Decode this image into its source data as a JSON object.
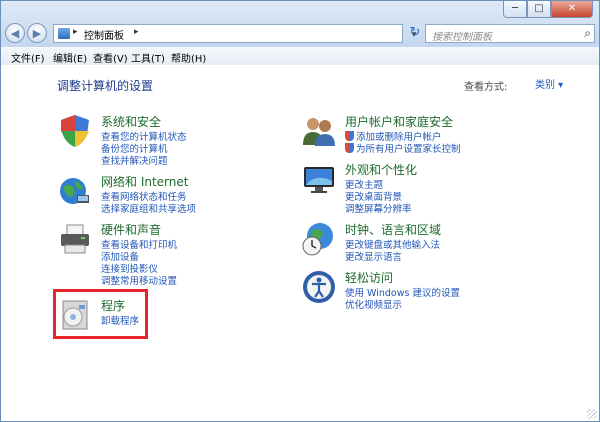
{
  "window": {
    "controls": {
      "minimize": "─",
      "maximize": "□",
      "close": "✕"
    }
  },
  "nav": {
    "back": "◀",
    "forward": "▶",
    "address": {
      "crumb": "控制面板",
      "sep1": "▸",
      "sep2": "▸",
      "dropdown": "▾"
    },
    "refresh": "↻",
    "search_placeholder": "搜索控制面板",
    "search_icon": "⌕"
  },
  "menu": {
    "items": [
      "文件(F)",
      "编辑(E)",
      "查看(V)",
      "工具(T)",
      "帮助(H)"
    ]
  },
  "main": {
    "title": "调整计算机的设置",
    "view_by_label": "查看方式:",
    "view_by_value": "类别 ▾"
  },
  "left_categories": [
    {
      "title": "系统和安全",
      "links": [
        "查看您的计算机状态",
        "备份您的计算机",
        "查找并解决问题"
      ],
      "icon": "shield-icon"
    },
    {
      "title": "网络和 Internet",
      "links": [
        "查看网络状态和任务",
        "选择家庭组和共享选项"
      ],
      "icon": "network-globe-icon"
    },
    {
      "title": "硬件和声音",
      "links": [
        "查看设备和打印机",
        "添加设备",
        "连接到投影仪",
        "调整常用移动设置"
      ],
      "icon": "printer-icon"
    },
    {
      "title": "程序",
      "links": [
        "卸载程序"
      ],
      "icon": "programs-disc-icon"
    }
  ],
  "right_categories": [
    {
      "title": "用户帐户和家庭安全",
      "links": [
        "添加或删除用户帐户",
        "为所有用户设置家长控制"
      ],
      "icon": "users-icon"
    },
    {
      "title": "外观和个性化",
      "links": [
        "更改主题",
        "更改桌面背景",
        "调整屏幕分辨率"
      ],
      "icon": "monitor-icon"
    },
    {
      "title": "时钟、语言和区域",
      "links": [
        "更改键盘或其他输入法",
        "更改显示语言"
      ],
      "icon": "clock-globe-icon"
    },
    {
      "title": "轻松访问",
      "links": [
        "使用 Windows 建议的设置",
        "优化视频显示"
      ],
      "icon": "accessibility-icon"
    }
  ],
  "colors": {
    "category_title": "#1e6b2d",
    "link": "#2257b8",
    "highlight_border": "#e8262a",
    "page_title": "#1e3a8a"
  }
}
